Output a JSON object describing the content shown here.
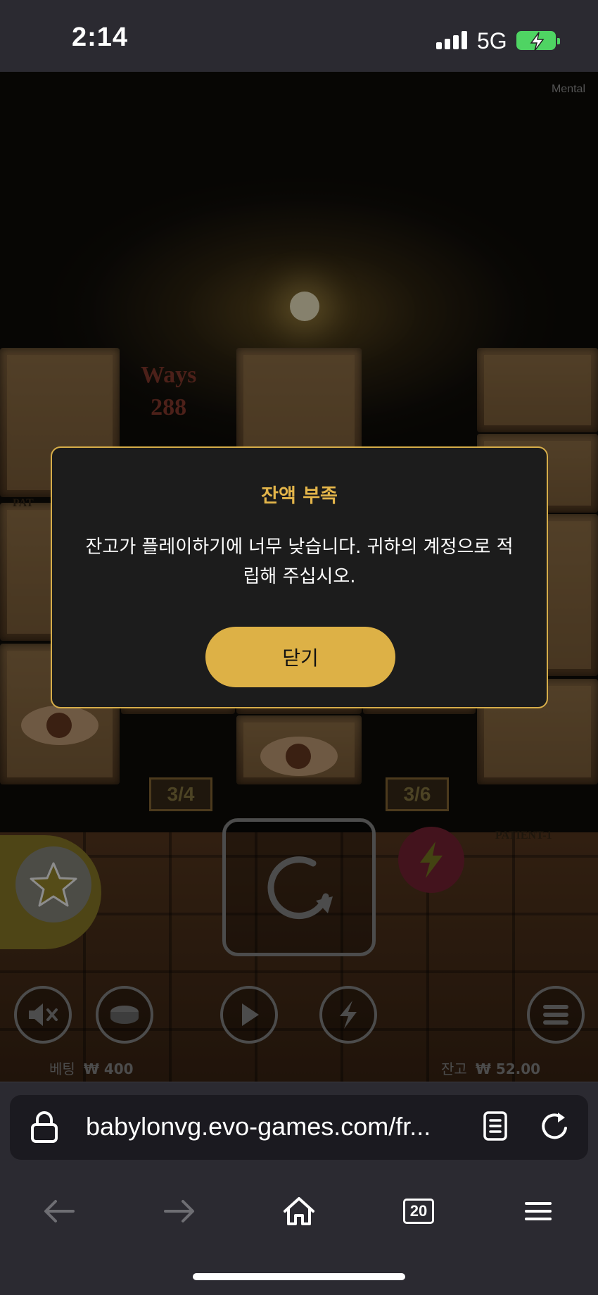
{
  "status_bar": {
    "time": "2:14",
    "network": "5G"
  },
  "game": {
    "tag": "Mental",
    "ways_label": "Ways",
    "ways_value": "288",
    "counter_left": "3/4",
    "counter_right": "3/6",
    "patient_label_left": "PAT",
    "patient_label_right": "PATIENT-1",
    "bet_label": "베팅",
    "bet_value": "₩ 400",
    "balance_label": "잔고",
    "balance_value": "₩ 52.00"
  },
  "modal": {
    "title": "잔액 부족",
    "message": "잔고가 플레이하기에 너무 낮습니다. 귀하의 계정으로 적립해 주십시오.",
    "close_label": "닫기"
  },
  "browser": {
    "url": "babylonvg.evo-games.com/fr...",
    "tabs_count": "20"
  },
  "colors": {
    "accent_gold": "#ddb146",
    "modal_bg": "#1c1c1c",
    "chrome_bg": "#2b2a31",
    "battery_green": "#4fd463"
  },
  "icons": [
    "signal-icon",
    "battery-charging-icon",
    "mute-icon",
    "coin-icon",
    "play-icon",
    "turbo-icon",
    "menu-icon",
    "spin-icon",
    "star-icon",
    "lock-icon",
    "reader-icon",
    "reload-icon",
    "back-icon",
    "forward-icon",
    "home-icon",
    "tabs-icon",
    "hamburger-icon"
  ]
}
